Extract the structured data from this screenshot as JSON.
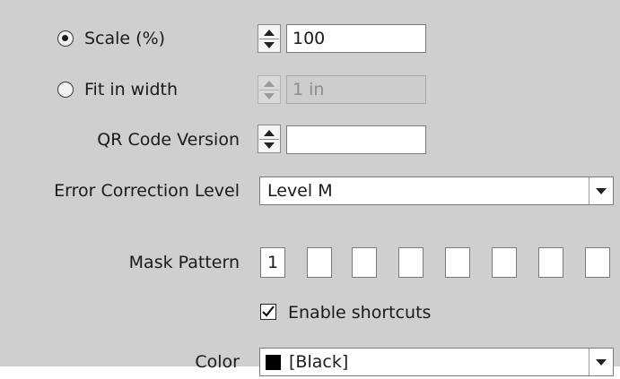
{
  "scale": {
    "label": "Scale (%)",
    "value": "100",
    "selected": true
  },
  "fit": {
    "label": "Fit in width",
    "value": "1 in",
    "selected": false
  },
  "qr_version": {
    "label": "QR Code Version",
    "value": ""
  },
  "error_correction": {
    "label": "Error Correction Level",
    "value": "Level M"
  },
  "mask_pattern": {
    "label": "Mask Pattern",
    "boxes": [
      "1",
      "",
      "",
      "",
      "",
      "",
      "",
      ""
    ]
  },
  "shortcuts": {
    "label": "Enable shortcuts",
    "checked": true
  },
  "color": {
    "label": "Color",
    "value": "[Black]",
    "swatch": "#000000"
  },
  "icons": {
    "spinner": "up-down-spinner-icon",
    "dropdown": "chevron-down-icon",
    "check": "checkmark-icon"
  }
}
